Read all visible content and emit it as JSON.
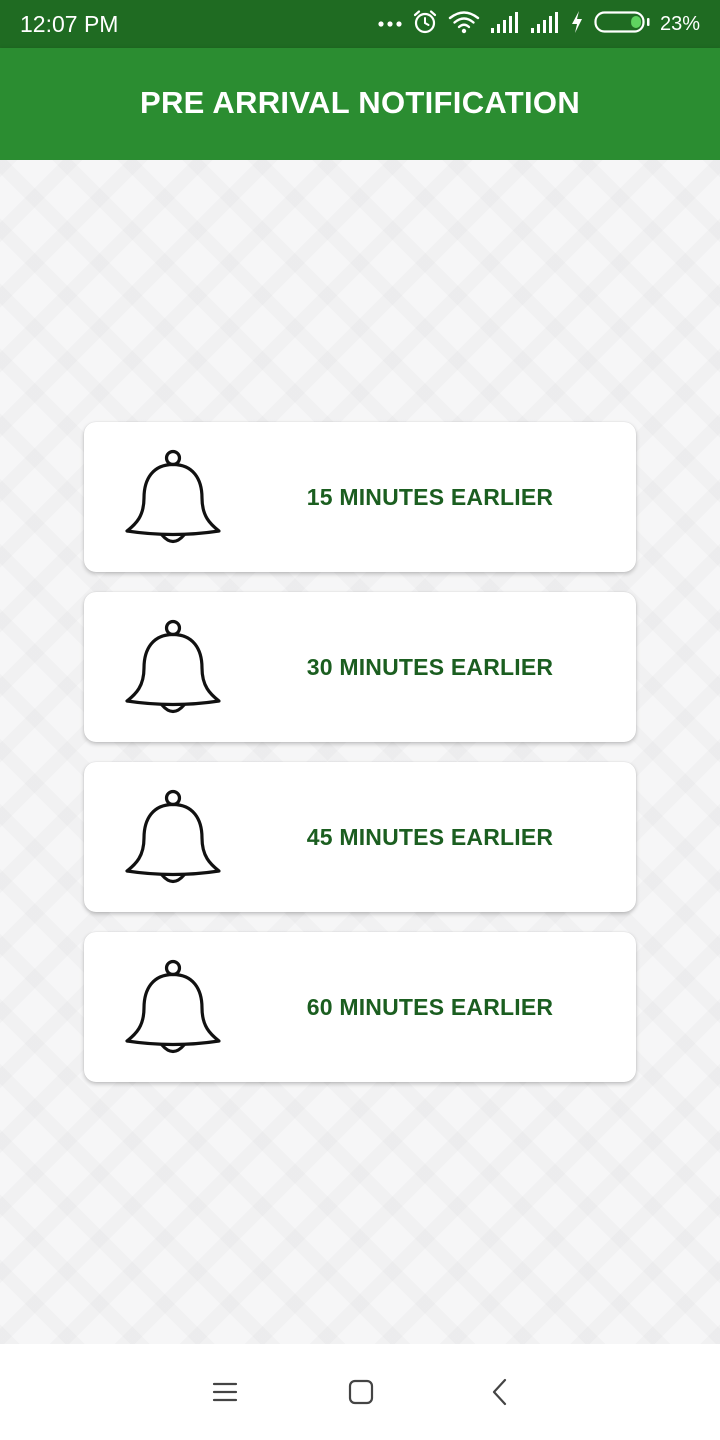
{
  "status_bar": {
    "time": "12:07 PM",
    "battery_percent": "23%",
    "battery_level": 0.23,
    "icons": [
      "more-dots-icon",
      "alarm-icon",
      "wifi-icon",
      "signal-icon",
      "signal-icon",
      "charging-icon",
      "battery-icon"
    ]
  },
  "app_bar": {
    "title": "PRE ARRIVAL NOTIFICATION",
    "color": "#2b8d31"
  },
  "options": [
    {
      "label": "15 MINUTES EARLIER",
      "icon": "bell-icon"
    },
    {
      "label": "30 MINUTES EARLIER",
      "icon": "bell-icon"
    },
    {
      "label": "45 MINUTES EARLIER",
      "icon": "bell-icon"
    },
    {
      "label": "60 MINUTES EARLIER",
      "icon": "bell-icon"
    }
  ],
  "label_color": "#1b5e20",
  "nav_bar": {
    "buttons": [
      "menu-icon",
      "home-square-icon",
      "back-chevron-icon"
    ]
  }
}
